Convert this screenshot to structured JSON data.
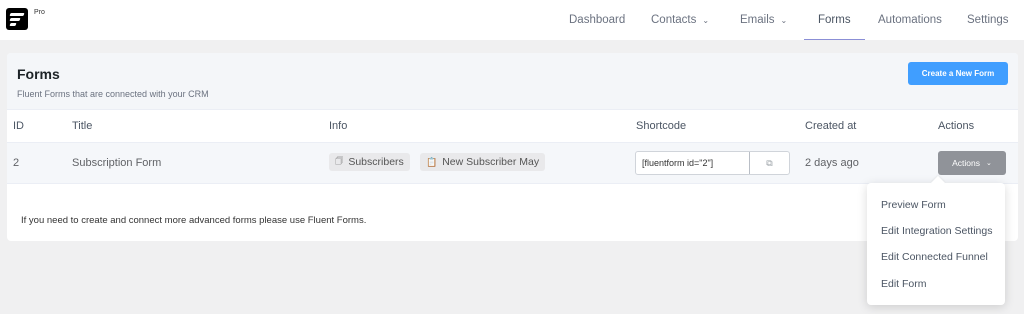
{
  "header": {
    "logo_badge": "Pro",
    "nav": [
      {
        "label": "Dashboard"
      },
      {
        "label": "Contacts",
        "has_dropdown": true
      },
      {
        "label": "Emails",
        "has_dropdown": true
      },
      {
        "label": "Forms",
        "active": true
      },
      {
        "label": "Automations"
      },
      {
        "label": "Settings"
      }
    ]
  },
  "page": {
    "title": "Forms",
    "subtitle": "Fluent Forms that are connected with your CRM",
    "create_button": "Create a New Form"
  },
  "table": {
    "columns": [
      "ID",
      "Title",
      "Info",
      "Shortcode",
      "Created at",
      "Actions"
    ],
    "rows": [
      {
        "id": "2",
        "title": "Subscription Form",
        "info": [
          {
            "icon": "folder-icon",
            "label": "Subscribers"
          },
          {
            "icon": "clipboard-icon",
            "label": "New Subscriber May"
          }
        ],
        "shortcode": "[fluentform id=\"2\"]",
        "created_at": "2 days ago",
        "actions_label": "Actions"
      }
    ]
  },
  "footnote": "If you need to create and connect more advanced forms please use Fluent Forms.",
  "actions_menu": {
    "items": [
      "Preview Form",
      "Edit Integration Settings",
      "Edit Connected Funnel",
      "Edit Form"
    ]
  },
  "colors": {
    "primary": "#409eff",
    "actions_button": "#909399",
    "active_nav_underline": "#8b8fd6"
  }
}
